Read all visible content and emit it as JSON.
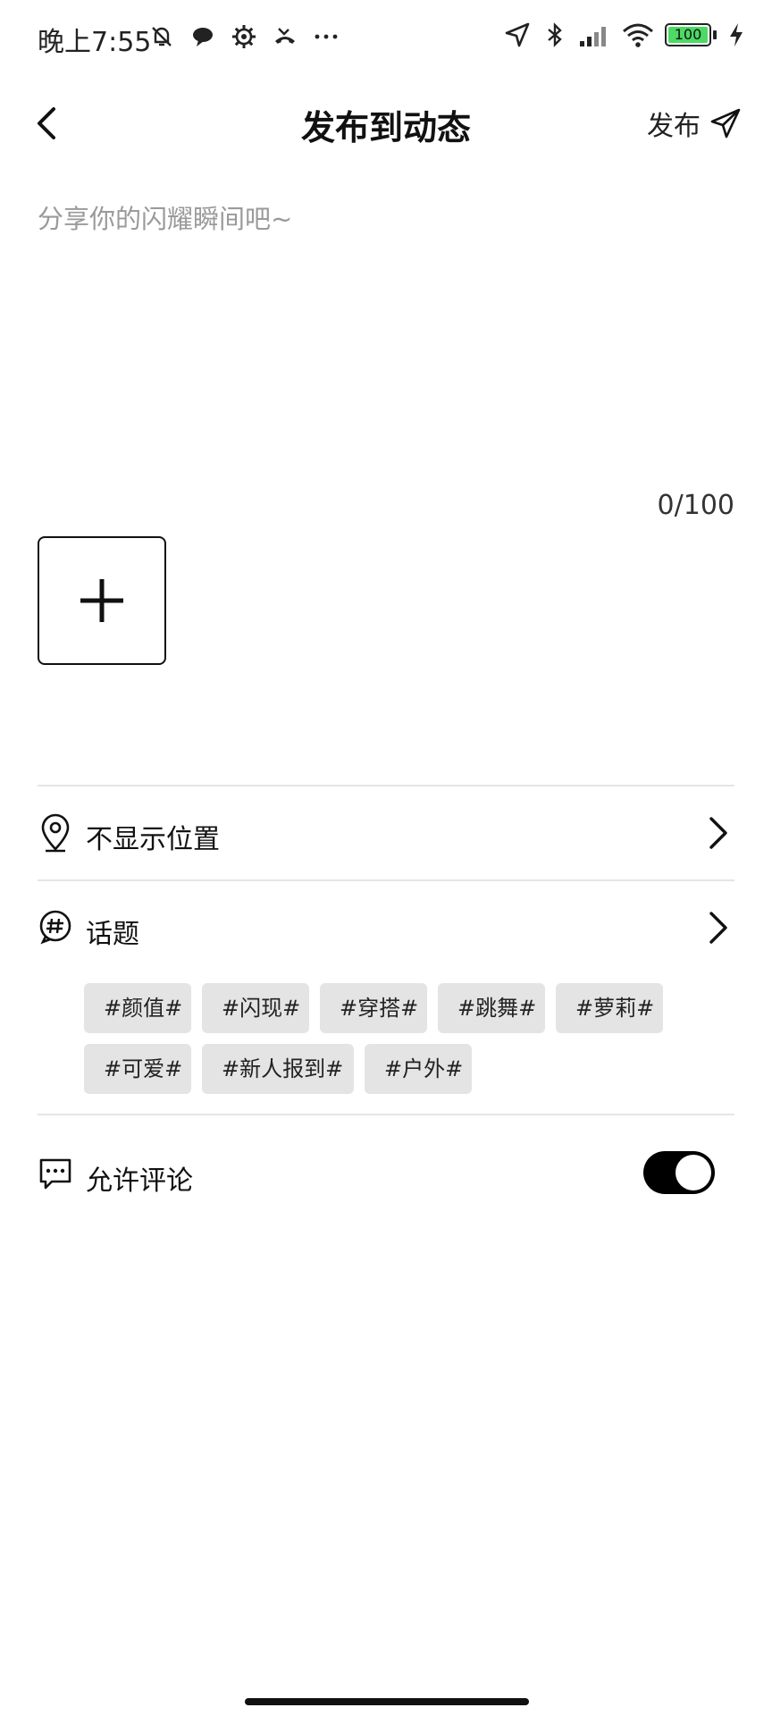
{
  "status_bar": {
    "time": "晚上7:55",
    "left_icons": [
      "bell-muted-icon",
      "chat-bubble-icon",
      "gear-icon",
      "missed-call-icon",
      "more-dots-icon"
    ],
    "right_icons": [
      "location-arrow-icon",
      "bluetooth-icon",
      "signal-icon",
      "wifi-icon",
      "battery-icon",
      "charging-icon"
    ],
    "battery_level": "100",
    "battery_fraction": 1.0,
    "battery_color": "#4cd964"
  },
  "nav": {
    "title": "发布到动态",
    "publish_label": "发布"
  },
  "composer": {
    "placeholder": "分享你的闪耀瞬间吧~",
    "value": "",
    "char_count": "0/100"
  },
  "location": {
    "label": "不显示位置"
  },
  "topic": {
    "label": "话题",
    "tags": [
      "#颜值#",
      "#闪现#",
      "#穿搭#",
      "#跳舞#",
      "#萝莉#",
      "#可爱#",
      "#新人报到#",
      "#户外#"
    ]
  },
  "comments": {
    "label": "允许评论",
    "enabled": true
  }
}
